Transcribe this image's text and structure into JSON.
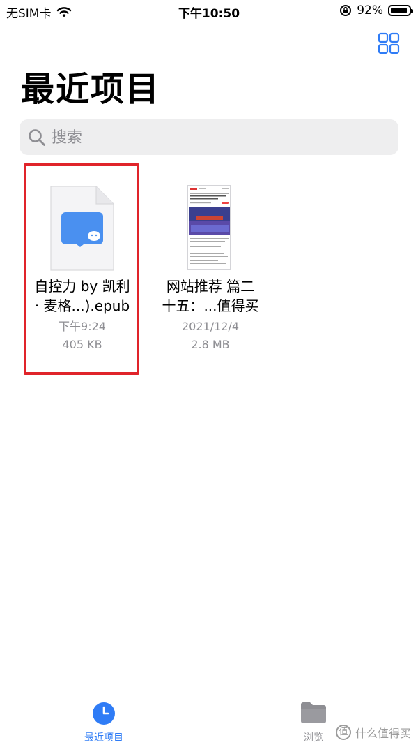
{
  "status_bar": {
    "carrier": "无SIM卡",
    "time": "下午10:50",
    "battery_percent": "92%",
    "battery_level": 0.92
  },
  "header": {
    "title": "最近项目"
  },
  "search": {
    "placeholder": "搜索"
  },
  "files": [
    {
      "name_line1": "自控力 by 凯利",
      "name_line2": "· 麦格...).epub",
      "date": "下午9:24",
      "size": "405 KB",
      "selected": true
    },
    {
      "name_line1": "网站推荐 篇二",
      "name_line2": "十五：...值得买",
      "date": "2021/12/4",
      "size": "2.8 MB",
      "selected": false
    }
  ],
  "tab_bar": {
    "recent_label": "最近项目",
    "browse_label": "浏览",
    "active_color": "#2f7cf6",
    "inactive_color": "#8e8e93"
  },
  "watermark": {
    "text": "什么值得买",
    "icon_glyph": "值"
  },
  "colors": {
    "highlight": "#e0242a",
    "accent": "#2f7cf6",
    "search_bg": "#eeeeef"
  }
}
